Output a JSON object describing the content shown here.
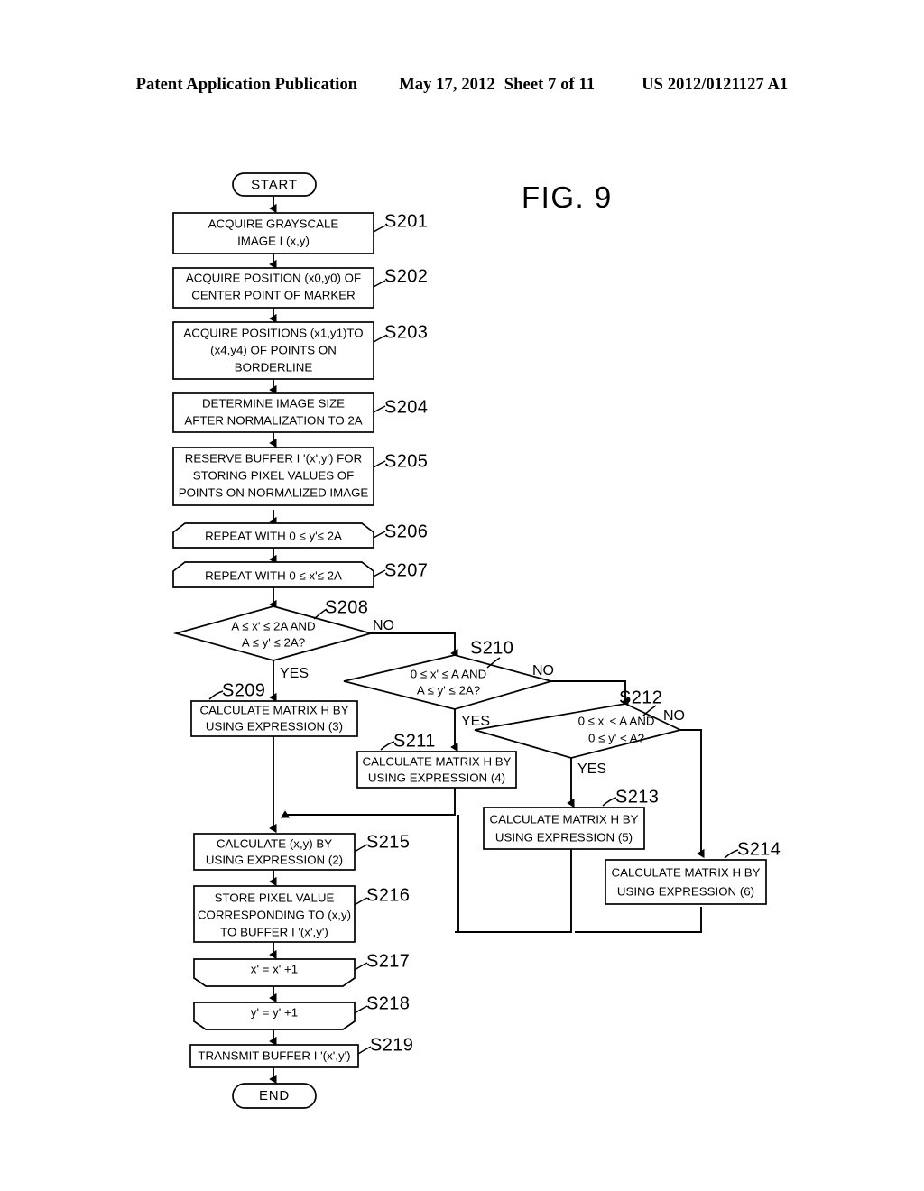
{
  "header": {
    "publication": "Patent Application Publication",
    "date": "May 17, 2012",
    "sheet": "Sheet 7 of 11",
    "patent_number": "US 2012/0121127 A1"
  },
  "figure": {
    "label": "FIG. 9"
  },
  "flowchart": {
    "start_label": "START",
    "end_label": "END",
    "branch_yes": "YES",
    "branch_no": "NO",
    "nodes": [
      {
        "id": "S201",
        "step": "S201",
        "shape": "process",
        "lines": [
          "ACQUIRE GRAYSCALE",
          "IMAGE I (x,y)"
        ]
      },
      {
        "id": "S202",
        "step": "S202",
        "shape": "process",
        "lines": [
          "ACQUIRE POSITION (x0,y0) OF",
          "CENTER POINT OF MARKER"
        ]
      },
      {
        "id": "S203",
        "step": "S203",
        "shape": "process",
        "lines": [
          "ACQUIRE POSITIONS (x1,y1)TO",
          "(x4,y4) OF POINTS ON",
          "BORDERLINE"
        ]
      },
      {
        "id": "S204",
        "step": "S204",
        "shape": "process",
        "lines": [
          "DETERMINE IMAGE SIZE",
          "AFTER NORMALIZATION TO 2A"
        ]
      },
      {
        "id": "S205",
        "step": "S205",
        "shape": "process",
        "lines": [
          "RESERVE BUFFER I '(x',y') FOR",
          "STORING PIXEL VALUES OF",
          "POINTS ON NORMALIZED IMAGE"
        ]
      },
      {
        "id": "S206",
        "step": "S206",
        "shape": "loop-start",
        "lines": [
          "REPEAT WITH 0 ≤ y'≤ 2A"
        ]
      },
      {
        "id": "S207",
        "step": "S207",
        "shape": "loop-start",
        "lines": [
          "REPEAT WITH 0 ≤ x'≤ 2A"
        ]
      },
      {
        "id": "S208",
        "step": "S208",
        "shape": "decision",
        "lines": [
          "A ≤ x' ≤ 2A AND",
          "A ≤ y' ≤ 2A?"
        ]
      },
      {
        "id": "S209",
        "step": "S209",
        "shape": "process",
        "lines": [
          "CALCULATE MATRIX H BY",
          "USING EXPRESSION (3)"
        ]
      },
      {
        "id": "S210",
        "step": "S210",
        "shape": "decision",
        "lines": [
          "0 ≤ x' ≤ A AND",
          "A ≤ y' ≤ 2A?"
        ]
      },
      {
        "id": "S211",
        "step": "S211",
        "shape": "process",
        "lines": [
          "CALCULATE MATRIX H BY",
          "USING EXPRESSION (4)"
        ]
      },
      {
        "id": "S212",
        "step": "S212",
        "shape": "decision",
        "lines": [
          "0 ≤ x' < A AND",
          "0 ≤ y' < A?"
        ]
      },
      {
        "id": "S213",
        "step": "S213",
        "shape": "process",
        "lines": [
          "CALCULATE MATRIX H BY",
          "USING EXPRESSION (5)"
        ]
      },
      {
        "id": "S214",
        "step": "S214",
        "shape": "process",
        "lines": [
          "CALCULATE MATRIX H BY",
          "USING EXPRESSION (6)"
        ]
      },
      {
        "id": "S215",
        "step": "S215",
        "shape": "process",
        "lines": [
          "CALCULATE (x,y) BY",
          "USING EXPRESSION (2)"
        ]
      },
      {
        "id": "S216",
        "step": "S216",
        "shape": "process",
        "lines": [
          "STORE PIXEL VALUE",
          "CORRESPONDING TO (x,y)",
          "TO BUFFER I '(x',y')"
        ]
      },
      {
        "id": "S217",
        "step": "S217",
        "shape": "loop-end",
        "lines": [
          "x' = x' +1"
        ]
      },
      {
        "id": "S218",
        "step": "S218",
        "shape": "loop-end",
        "lines": [
          "y' = y' +1"
        ]
      },
      {
        "id": "S219",
        "step": "S219",
        "shape": "process",
        "lines": [
          "TRANSMIT BUFFER I '(x',y')"
        ]
      }
    ],
    "branches": [
      {
        "from": "S208",
        "label": "NO"
      },
      {
        "from": "S208",
        "label": "YES"
      },
      {
        "from": "S210",
        "label": "NO"
      },
      {
        "from": "S210",
        "label": "YES"
      },
      {
        "from": "S212",
        "label": "NO"
      },
      {
        "from": "S212",
        "label": "YES"
      }
    ]
  },
  "colors": {
    "ink": "#000000",
    "paper": "#ffffff"
  }
}
